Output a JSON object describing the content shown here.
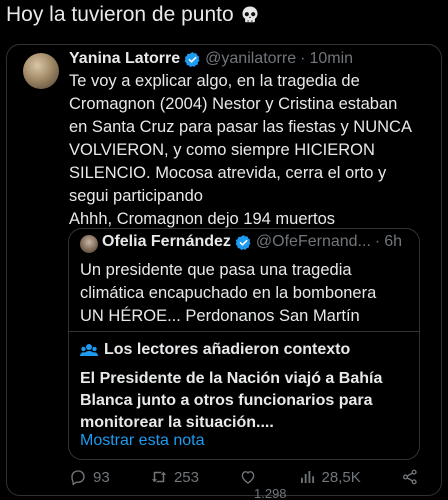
{
  "caption": {
    "text": "Hoy la tuvieron de punto"
  },
  "tweet": {
    "author_name": "Yanina Latorre",
    "handle": "@yanilatorre",
    "separator": "·",
    "time": "10min",
    "lines": [
      "Te voy a explicar algo, en la tragedia de",
      "Cromagnon (2004) Nestor y Cristina estaban",
      "en Santa Cruz para pasar las fiestas y NUNCA",
      "VOLVIERON, y como siempre HICIERON",
      "SILENCIO. Mocosa atrevida, cerra el orto y",
      "segui participando",
      "Ahhh, Cromagnon dejo 194 muertos"
    ]
  },
  "quote": {
    "author_name": "Ofelia Fernández",
    "handle": "@OfeFernand...",
    "separator": "·",
    "time": "6h",
    "lines": [
      "Un presidente que pasa una tragedia",
      "climática encapuchado en la bombonera",
      "UN HÉROE... Perdonanos San Martín"
    ]
  },
  "context": {
    "title": "Los lectores añadieron contexto",
    "lines": [
      "El Presidente de la Nación viajó a Bahía",
      "Blanca junto a otros funcionarios para",
      "monitorear la situación...."
    ],
    "link": "Mostrar esta nota"
  },
  "actions": {
    "replies": "93",
    "retweets": "253",
    "likes": "1.298",
    "views": "28,5K"
  },
  "colors": {
    "background": "#000000",
    "text": "#e7e9ea",
    "muted": "#71767b",
    "border": "#2f3336",
    "link": "#1d9bf0"
  }
}
